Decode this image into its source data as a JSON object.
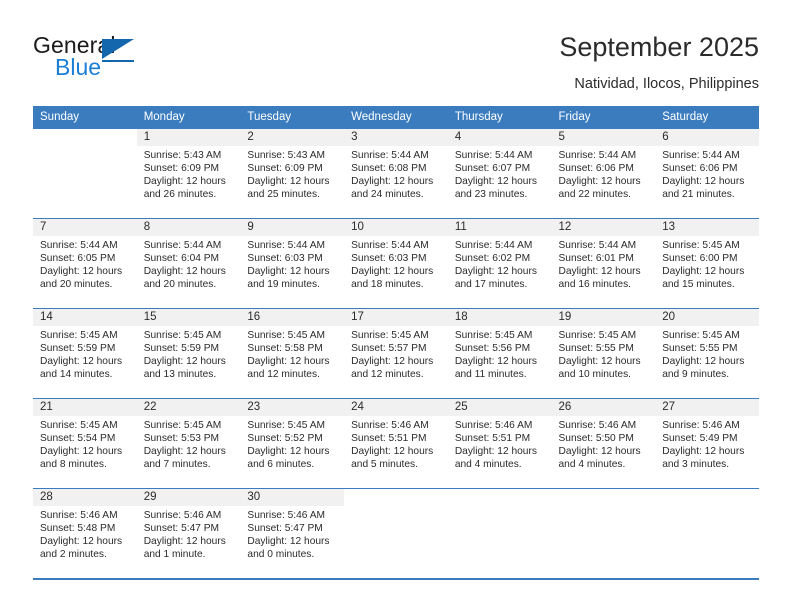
{
  "brand": {
    "name_part1": "General",
    "name_part2": "Blue",
    "primary_color": "#1567ad",
    "accent_color": "#1c7fd6"
  },
  "header": {
    "title": "September 2025",
    "subtitle": "Natividad, Ilocos, Philippines"
  },
  "calendar": {
    "header_bg": "#3a7cbe",
    "daynum_bg": "#f1f1f1",
    "weekdays": [
      "Sunday",
      "Monday",
      "Tuesday",
      "Wednesday",
      "Thursday",
      "Friday",
      "Saturday"
    ],
    "weeks": [
      [
        {
          "day": "",
          "sunrise": "",
          "sunset": "",
          "daylight1": "",
          "daylight2": ""
        },
        {
          "day": "1",
          "sunrise": "Sunrise: 5:43 AM",
          "sunset": "Sunset: 6:09 PM",
          "daylight1": "Daylight: 12 hours",
          "daylight2": "and 26 minutes."
        },
        {
          "day": "2",
          "sunrise": "Sunrise: 5:43 AM",
          "sunset": "Sunset: 6:09 PM",
          "daylight1": "Daylight: 12 hours",
          "daylight2": "and 25 minutes."
        },
        {
          "day": "3",
          "sunrise": "Sunrise: 5:44 AM",
          "sunset": "Sunset: 6:08 PM",
          "daylight1": "Daylight: 12 hours",
          "daylight2": "and 24 minutes."
        },
        {
          "day": "4",
          "sunrise": "Sunrise: 5:44 AM",
          "sunset": "Sunset: 6:07 PM",
          "daylight1": "Daylight: 12 hours",
          "daylight2": "and 23 minutes."
        },
        {
          "day": "5",
          "sunrise": "Sunrise: 5:44 AM",
          "sunset": "Sunset: 6:06 PM",
          "daylight1": "Daylight: 12 hours",
          "daylight2": "and 22 minutes."
        },
        {
          "day": "6",
          "sunrise": "Sunrise: 5:44 AM",
          "sunset": "Sunset: 6:06 PM",
          "daylight1": "Daylight: 12 hours",
          "daylight2": "and 21 minutes."
        }
      ],
      [
        {
          "day": "7",
          "sunrise": "Sunrise: 5:44 AM",
          "sunset": "Sunset: 6:05 PM",
          "daylight1": "Daylight: 12 hours",
          "daylight2": "and 20 minutes."
        },
        {
          "day": "8",
          "sunrise": "Sunrise: 5:44 AM",
          "sunset": "Sunset: 6:04 PM",
          "daylight1": "Daylight: 12 hours",
          "daylight2": "and 20 minutes."
        },
        {
          "day": "9",
          "sunrise": "Sunrise: 5:44 AM",
          "sunset": "Sunset: 6:03 PM",
          "daylight1": "Daylight: 12 hours",
          "daylight2": "and 19 minutes."
        },
        {
          "day": "10",
          "sunrise": "Sunrise: 5:44 AM",
          "sunset": "Sunset: 6:03 PM",
          "daylight1": "Daylight: 12 hours",
          "daylight2": "and 18 minutes."
        },
        {
          "day": "11",
          "sunrise": "Sunrise: 5:44 AM",
          "sunset": "Sunset: 6:02 PM",
          "daylight1": "Daylight: 12 hours",
          "daylight2": "and 17 minutes."
        },
        {
          "day": "12",
          "sunrise": "Sunrise: 5:44 AM",
          "sunset": "Sunset: 6:01 PM",
          "daylight1": "Daylight: 12 hours",
          "daylight2": "and 16 minutes."
        },
        {
          "day": "13",
          "sunrise": "Sunrise: 5:45 AM",
          "sunset": "Sunset: 6:00 PM",
          "daylight1": "Daylight: 12 hours",
          "daylight2": "and 15 minutes."
        }
      ],
      [
        {
          "day": "14",
          "sunrise": "Sunrise: 5:45 AM",
          "sunset": "Sunset: 5:59 PM",
          "daylight1": "Daylight: 12 hours",
          "daylight2": "and 14 minutes."
        },
        {
          "day": "15",
          "sunrise": "Sunrise: 5:45 AM",
          "sunset": "Sunset: 5:59 PM",
          "daylight1": "Daylight: 12 hours",
          "daylight2": "and 13 minutes."
        },
        {
          "day": "16",
          "sunrise": "Sunrise: 5:45 AM",
          "sunset": "Sunset: 5:58 PM",
          "daylight1": "Daylight: 12 hours",
          "daylight2": "and 12 minutes."
        },
        {
          "day": "17",
          "sunrise": "Sunrise: 5:45 AM",
          "sunset": "Sunset: 5:57 PM",
          "daylight1": "Daylight: 12 hours",
          "daylight2": "and 12 minutes."
        },
        {
          "day": "18",
          "sunrise": "Sunrise: 5:45 AM",
          "sunset": "Sunset: 5:56 PM",
          "daylight1": "Daylight: 12 hours",
          "daylight2": "and 11 minutes."
        },
        {
          "day": "19",
          "sunrise": "Sunrise: 5:45 AM",
          "sunset": "Sunset: 5:55 PM",
          "daylight1": "Daylight: 12 hours",
          "daylight2": "and 10 minutes."
        },
        {
          "day": "20",
          "sunrise": "Sunrise: 5:45 AM",
          "sunset": "Sunset: 5:55 PM",
          "daylight1": "Daylight: 12 hours",
          "daylight2": "and 9 minutes."
        }
      ],
      [
        {
          "day": "21",
          "sunrise": "Sunrise: 5:45 AM",
          "sunset": "Sunset: 5:54 PM",
          "daylight1": "Daylight: 12 hours",
          "daylight2": "and 8 minutes."
        },
        {
          "day": "22",
          "sunrise": "Sunrise: 5:45 AM",
          "sunset": "Sunset: 5:53 PM",
          "daylight1": "Daylight: 12 hours",
          "daylight2": "and 7 minutes."
        },
        {
          "day": "23",
          "sunrise": "Sunrise: 5:45 AM",
          "sunset": "Sunset: 5:52 PM",
          "daylight1": "Daylight: 12 hours",
          "daylight2": "and 6 minutes."
        },
        {
          "day": "24",
          "sunrise": "Sunrise: 5:46 AM",
          "sunset": "Sunset: 5:51 PM",
          "daylight1": "Daylight: 12 hours",
          "daylight2": "and 5 minutes."
        },
        {
          "day": "25",
          "sunrise": "Sunrise: 5:46 AM",
          "sunset": "Sunset: 5:51 PM",
          "daylight1": "Daylight: 12 hours",
          "daylight2": "and 4 minutes."
        },
        {
          "day": "26",
          "sunrise": "Sunrise: 5:46 AM",
          "sunset": "Sunset: 5:50 PM",
          "daylight1": "Daylight: 12 hours",
          "daylight2": "and 4 minutes."
        },
        {
          "day": "27",
          "sunrise": "Sunrise: 5:46 AM",
          "sunset": "Sunset: 5:49 PM",
          "daylight1": "Daylight: 12 hours",
          "daylight2": "and 3 minutes."
        }
      ],
      [
        {
          "day": "28",
          "sunrise": "Sunrise: 5:46 AM",
          "sunset": "Sunset: 5:48 PM",
          "daylight1": "Daylight: 12 hours",
          "daylight2": "and 2 minutes."
        },
        {
          "day": "29",
          "sunrise": "Sunrise: 5:46 AM",
          "sunset": "Sunset: 5:47 PM",
          "daylight1": "Daylight: 12 hours",
          "daylight2": "and 1 minute."
        },
        {
          "day": "30",
          "sunrise": "Sunrise: 5:46 AM",
          "sunset": "Sunset: 5:47 PM",
          "daylight1": "Daylight: 12 hours",
          "daylight2": "and 0 minutes."
        },
        {
          "day": "",
          "sunrise": "",
          "sunset": "",
          "daylight1": "",
          "daylight2": ""
        },
        {
          "day": "",
          "sunrise": "",
          "sunset": "",
          "daylight1": "",
          "daylight2": ""
        },
        {
          "day": "",
          "sunrise": "",
          "sunset": "",
          "daylight1": "",
          "daylight2": ""
        },
        {
          "day": "",
          "sunrise": "",
          "sunset": "",
          "daylight1": "",
          "daylight2": ""
        }
      ]
    ]
  }
}
